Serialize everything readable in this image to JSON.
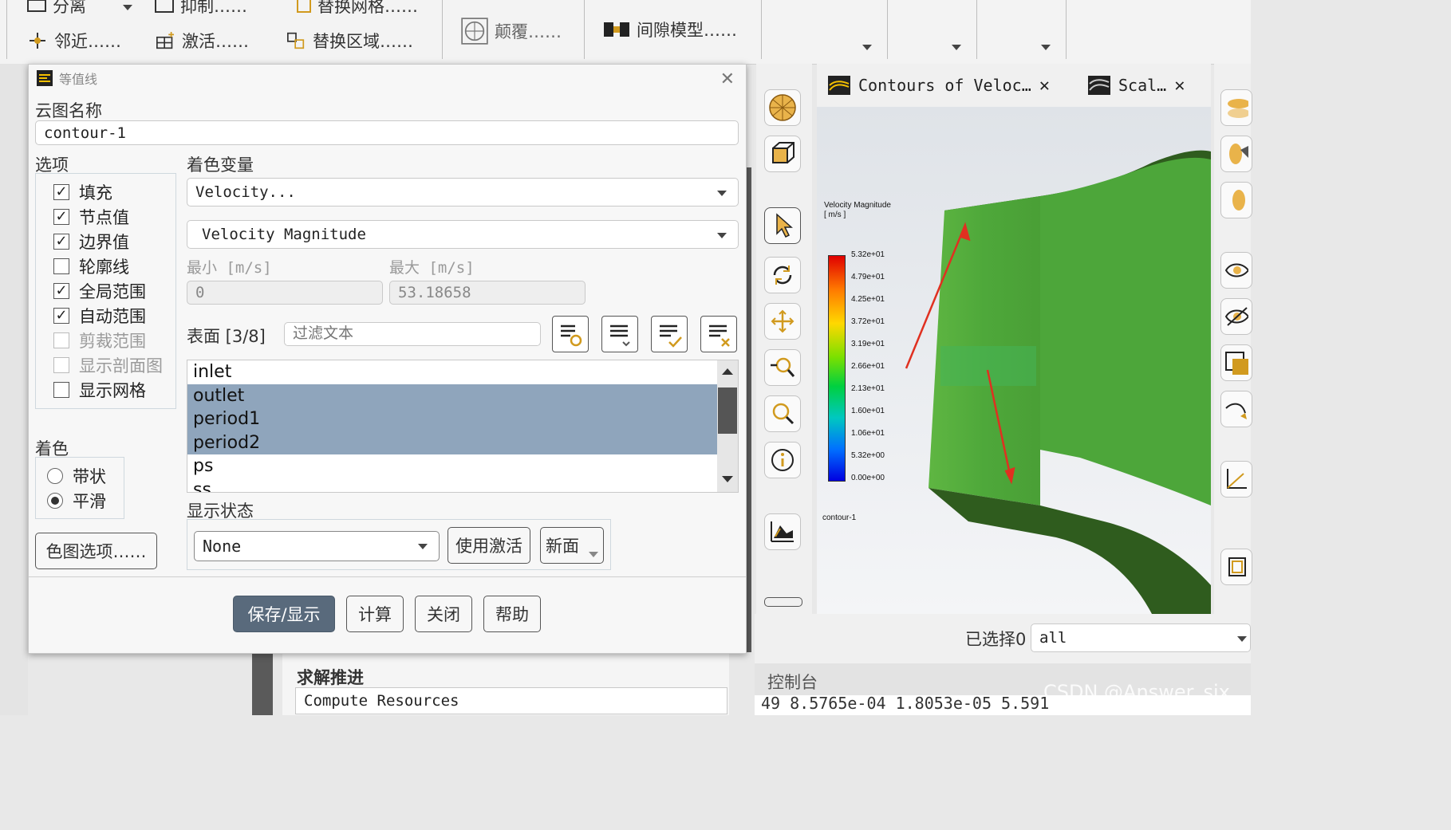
{
  "ribbon": {
    "row1": [
      "分离",
      "抑制……",
      "替换网格……"
    ],
    "row2": [
      "邻近……",
      "激活……",
      "替换区域……"
    ],
    "group2": [
      "颠覆……",
      "间隙模型……"
    ]
  },
  "dialog": {
    "title": "等值线",
    "name_label": "云图名称",
    "name_value": "contour-1",
    "options_label": "选项",
    "options": [
      {
        "label": "填充",
        "checked": true,
        "enabled": true
      },
      {
        "label": "节点值",
        "checked": true,
        "enabled": true
      },
      {
        "label": "边界值",
        "checked": true,
        "enabled": true
      },
      {
        "label": "轮廓线",
        "checked": false,
        "enabled": true
      },
      {
        "label": "全局范围",
        "checked": true,
        "enabled": true
      },
      {
        "label": "自动范围",
        "checked": true,
        "enabled": true
      },
      {
        "label": "剪裁范围",
        "checked": false,
        "enabled": false
      },
      {
        "label": "显示剖面图",
        "checked": false,
        "enabled": false
      },
      {
        "label": "显示网格",
        "checked": false,
        "enabled": true
      }
    ],
    "coloring_label": "着色",
    "coloring": [
      {
        "label": "带状",
        "selected": false
      },
      {
        "label": "平滑",
        "selected": true
      }
    ],
    "colormap_button": "色图选项……",
    "color_var_label": "着色变量",
    "color_var": "Velocity...",
    "color_subvar": "Velocity Magnitude",
    "min_label": "最小 [m/s]",
    "max_label": "最大 [m/s]",
    "min_value": "0",
    "max_value": "53.18658",
    "surfaces_label": "表面 [3/8]",
    "filter_placeholder": "过滤文本",
    "surfaces": [
      {
        "name": "inlet",
        "selected": false
      },
      {
        "name": "outlet",
        "selected": true
      },
      {
        "name": "period1",
        "selected": true
      },
      {
        "name": "period2",
        "selected": true
      },
      {
        "name": "ps",
        "selected": false
      },
      {
        "name": "ss",
        "selected": false
      }
    ],
    "display_state_label": "显示状态",
    "display_state_value": "None",
    "use_active_button": "使用激活",
    "new_surface_button": "新面",
    "buttons": {
      "save": "保存/显示",
      "compute": "计算",
      "close": "关闭",
      "help": "帮助"
    }
  },
  "behind": {
    "section_title": "求解推进",
    "section_item": "Compute Resources"
  },
  "graphics": {
    "tabs": [
      "Contours of Veloc…",
      "Scal…"
    ],
    "legend_title": "Velocity Magnitude",
    "legend_unit": "[ m/s ]",
    "legend_ticks": [
      "5.32e+01",
      "4.79e+01",
      "4.25e+01",
      "3.72e+01",
      "3.19e+01",
      "2.66e+01",
      "2.13e+01",
      "1.60e+01",
      "1.06e+01",
      "5.32e+00",
      "0.00e+00"
    ],
    "contour_name": "contour-1",
    "selected_label": "已选择0",
    "selected_value": "all"
  },
  "console": {
    "title": "控制台",
    "line": " 49   8.5765e-04   1.8053e-05   5.591",
    "watermark": "CSDN @Answer_six"
  },
  "colors": {
    "selected_row": "#8fa5bc",
    "primary_button": "#596a7c",
    "shape_green": "#4fa23a"
  }
}
